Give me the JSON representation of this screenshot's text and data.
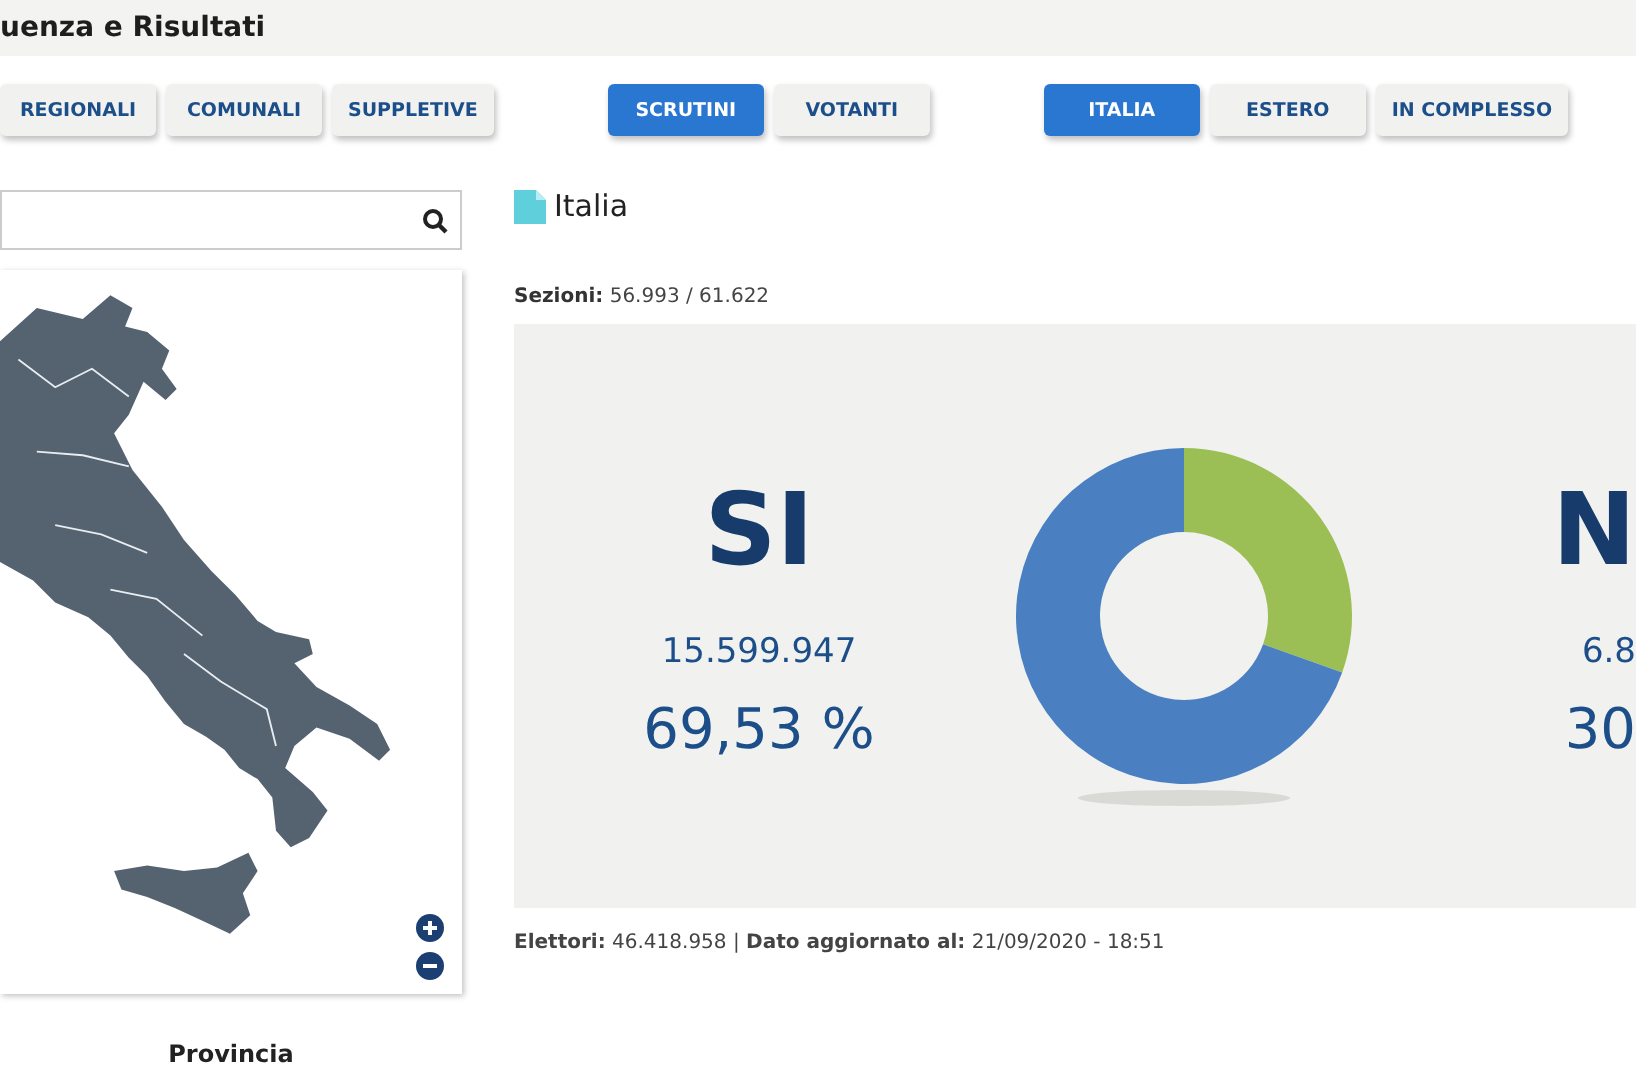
{
  "header": {
    "title": "uenza e Risultati"
  },
  "button_groups": [
    {
      "buttons": [
        {
          "label": "REGIONALI",
          "selected": false
        },
        {
          "label": "COMUNALI",
          "selected": false
        },
        {
          "label": "SUPPLETIVE",
          "selected": false
        }
      ]
    },
    {
      "buttons": [
        {
          "label": "SCRUTINI",
          "selected": true
        },
        {
          "label": "VOTANTI",
          "selected": false
        }
      ]
    },
    {
      "buttons": [
        {
          "label": "ITALIA",
          "selected": true
        },
        {
          "label": "ESTERO",
          "selected": false
        },
        {
          "label": "IN COMPLESSO",
          "selected": false
        }
      ]
    }
  ],
  "map_panel": {
    "footer_label": "Provincia"
  },
  "area": {
    "title": "Italia",
    "sections": "**Sezioni:** 56.993 / 61.622"
  },
  "results": {
    "left": {
      "label": "SI",
      "votes": "15.599.947",
      "percent": "69,53 %"
    },
    "right": {
      "label": "N",
      "votes": "6.8",
      "percent": "30"
    },
    "chart_data": {
      "type": "donut",
      "values": [
        69.53,
        30.47
      ],
      "colors": [
        "#4a7fc1",
        "#9bbf55"
      ]
    }
  },
  "footer": {
    "text": "**Elettori:** 46.418.958 | **Dato aggiornato al:** 21/09/2020 - 18:51"
  }
}
